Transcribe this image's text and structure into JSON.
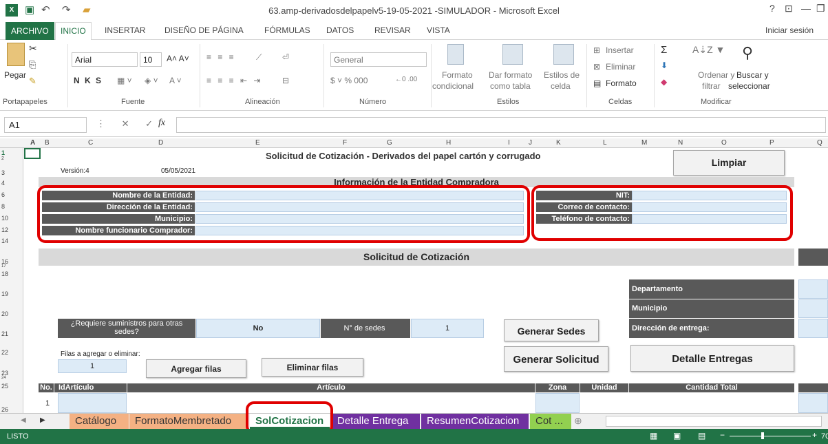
{
  "window": {
    "title": "63.amp-derivadosdelpapelv5-19-05-2021 -SIMULADOR - Microsoft Excel",
    "help": "?",
    "signin": "Iniciar sesión"
  },
  "ribbon_tabs": [
    "ARCHIVO",
    "INICIO",
    "INSERTAR",
    "DISEÑO DE PÁGINA",
    "FÓRMULAS",
    "DATOS",
    "REVISAR",
    "VISTA"
  ],
  "ribbon": {
    "paste": "Pegar",
    "font_name": "Arial",
    "font_size": "10",
    "font_btns": "N  K  S",
    "number_format": "General",
    "cond_format": [
      "Formato",
      "condicional"
    ],
    "table_format": [
      "Dar formato",
      "como tabla"
    ],
    "cell_styles": [
      "Estilos de",
      "celda"
    ],
    "insert": "Insertar",
    "delete": "Eliminar",
    "format": "Formato",
    "sort": [
      "Ordenar y",
      "filtrar"
    ],
    "find": [
      "Buscar y",
      "seleccionar"
    ],
    "groups": [
      "Portapapeles",
      "Fuente",
      "Alineación",
      "Número",
      "Estilos",
      "Celdas",
      "Modificar"
    ]
  },
  "formula_bar": {
    "name_box": "A1",
    "fx": "fx"
  },
  "columns": [
    "A",
    "B",
    "C",
    "D",
    "E",
    "F",
    "G",
    "H",
    "I",
    "J",
    "K",
    "L",
    "M",
    "N",
    "O",
    "P",
    "Q"
  ],
  "rows": [
    "1",
    "2",
    "3",
    "4",
    "6",
    "8",
    "10",
    "12",
    "14",
    "16",
    "17",
    "18",
    "19",
    "20",
    "21",
    "22",
    "23",
    "24",
    "25",
    "26"
  ],
  "sheet": {
    "title": "Solicitud de Cotización - Derivados del papel cartón y corrugado",
    "version_label": "Versión:4",
    "date": "05/05/2021",
    "limpiar": "Limpiar",
    "entidad_header": "Información de la Entidad Compradora",
    "fields_left": [
      "Nombre de la Entidad:",
      "Dirección de la Entidad:",
      "Municipio:",
      "Nombre funcionario Comprador:"
    ],
    "fields_right": [
      "NIT:",
      "Correo de contacto:",
      "Teléfono de contacto:"
    ],
    "solicitud_header": "Solicitud de Cotización",
    "right_labels": [
      "Departamento",
      "Municipio",
      "Dirección de entrega:"
    ],
    "otras_sedes_q": "¿Requiere suministros para otras sedes?",
    "otras_sedes_a": "No",
    "n_sedes_label": "N° de sedes",
    "n_sedes_value": "1",
    "generar_sedes": "Generar Sedes",
    "filas_label": "Filas a agregar o eliminar:",
    "filas_value": "1",
    "agregar_filas": "Agregar filas",
    "eliminar_filas": "Eliminar filas",
    "generar_solicitud": "Generar Solicitud",
    "detalle_entregas": "Detalle Entregas",
    "table_headers": [
      "No.",
      "IdArtículo",
      "Artículo",
      "Zona",
      "Unidad",
      "Cantidad Total"
    ],
    "first_row_no": "1"
  },
  "sheet_tabs": [
    {
      "label": "Catálogo",
      "color": "#f4b183"
    },
    {
      "label": "FormatoMembretado",
      "color": "#f4b183"
    },
    {
      "label": "SolCotizacion",
      "color": "#ffffff"
    },
    {
      "label": "Detalle Entrega",
      "color": "#7030a0"
    },
    {
      "label": "ResumenCotizacion",
      "color": "#7030a0"
    },
    {
      "label": "Cot ...",
      "color": "#92d050"
    }
  ],
  "status": {
    "text": "LISTO",
    "zoom": "70"
  },
  "colors": {
    "excel_green": "#217346",
    "highlight_red": "#e00000",
    "input_blue": "#ddebf7",
    "dark_label": "#595959"
  }
}
